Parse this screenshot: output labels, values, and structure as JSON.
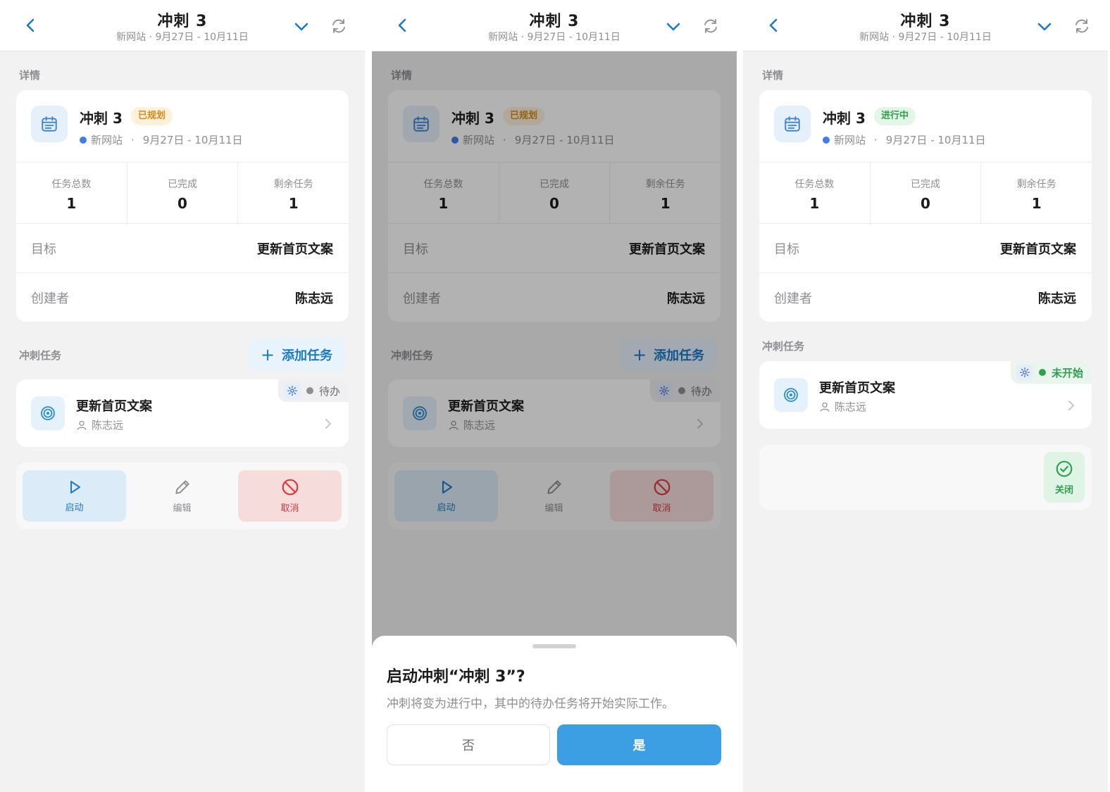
{
  "header": {
    "title": "冲刺 3",
    "subtitle": "新网站 · 9月27日 - 10月11日"
  },
  "labels": {
    "details": "详情",
    "tasks_section": "冲刺任务",
    "add_task": "添加任务"
  },
  "sprint": {
    "name": "冲刺 3",
    "project": "新网站",
    "separator": "·",
    "date_range": "9月27日 - 10月11日",
    "project_color": "#3f7ee8"
  },
  "stats": [
    {
      "label": "任务总数",
      "value": "1"
    },
    {
      "label": "已完成",
      "value": "0"
    },
    {
      "label": "剩余任务",
      "value": "1"
    }
  ],
  "fields": {
    "goal_label": "目标",
    "goal_value": "更新首页文案",
    "creator_label": "创建者",
    "creator_value": "陈志远"
  },
  "task": {
    "title": "更新首页文案",
    "owner": "陈志远"
  },
  "status": {
    "planned": "已规划",
    "in_progress": "进行中",
    "todo": "待办",
    "not_started": "未开始"
  },
  "actions": {
    "start": "启动",
    "edit": "编辑",
    "cancel": "取消",
    "close": "关闭"
  },
  "dialog": {
    "title": "启动冲刺“冲刺 3”?",
    "message": "冲刺将变为进行中，其中的待办任务将开始实际工作。",
    "no": "否",
    "yes": "是"
  },
  "colors": {
    "accent": "#1b7ac9",
    "planned": "#d98a1a",
    "in_progress": "#2fa14c",
    "cancel": "#d83a3a",
    "confirm": "#3d9fe3"
  }
}
